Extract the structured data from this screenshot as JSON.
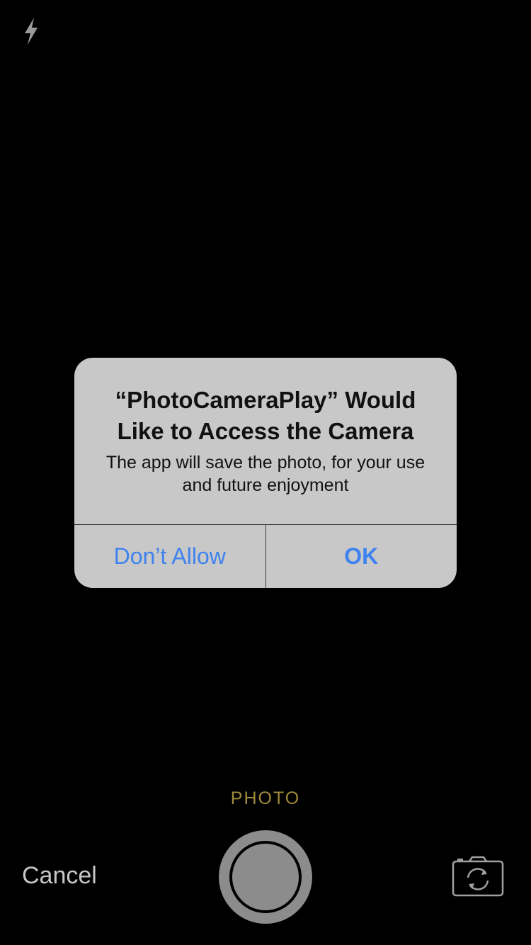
{
  "camera": {
    "mode_label": "PHOTO",
    "cancel_label": "Cancel",
    "flash_icon": "flash-icon",
    "switch_icon": "switch-camera-icon"
  },
  "alert": {
    "title": "“PhotoCameraPlay” Would Like to Access the Camera",
    "message": "The app will save the photo, for your use and future enjoyment",
    "deny_label": "Don’t Allow",
    "allow_label": "OK"
  },
  "colors": {
    "background": "#000000",
    "alert_bg": "#c8c8c8",
    "link_blue": "#3f82ef",
    "mode_gold": "#a08a3c",
    "control_gray": "#8c8c8c"
  }
}
